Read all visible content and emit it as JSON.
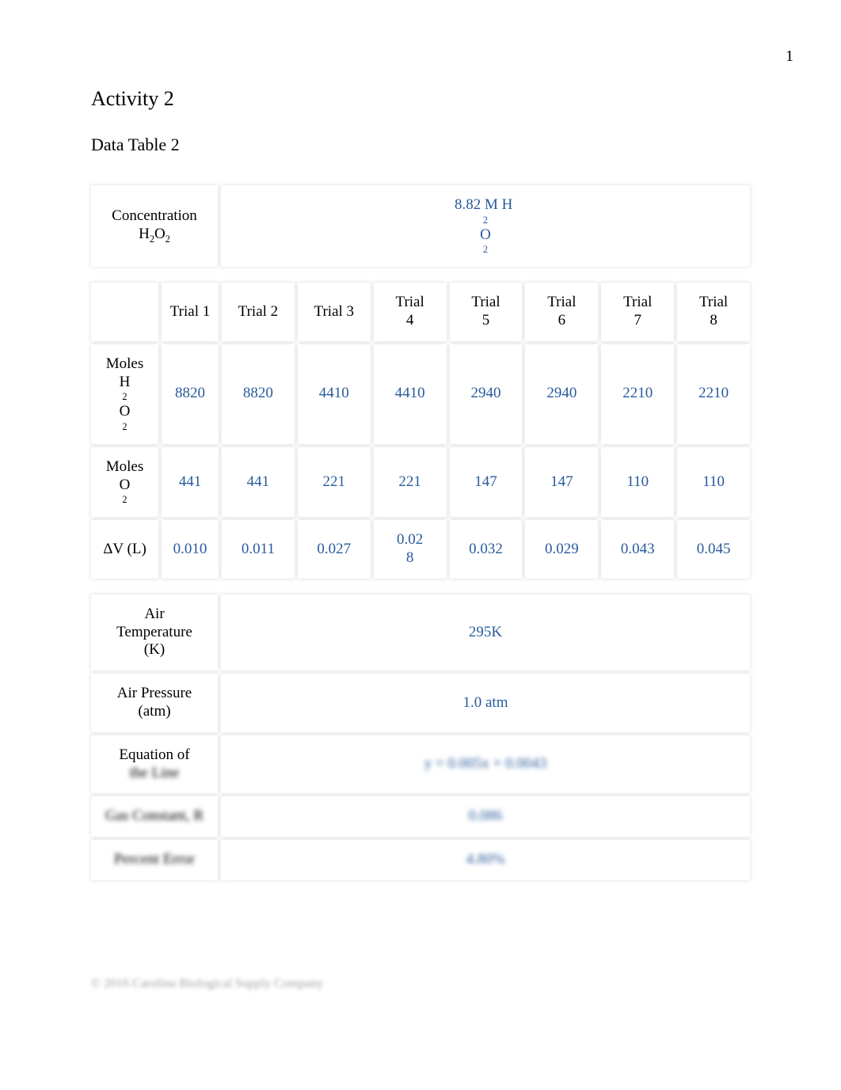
{
  "page_number": "1",
  "title": "Activity 2",
  "subtitle": "Data Table 2",
  "section1": {
    "label": "Concentration H₂O₂",
    "value": "8.82 M H  ₂O₂"
  },
  "trials": {
    "row_label_col": "",
    "header": [
      "Trial 1",
      "Trial 2",
      "Trial 3",
      "Trial 4",
      "Trial 5",
      "Trial 6",
      "Trial 7",
      "Trial 8"
    ],
    "rows": [
      {
        "label": "Moles H₂O₂",
        "values": [
          "8820",
          "8820",
          "4410",
          "4410",
          "2940",
          "2940",
          "2210",
          "2210"
        ]
      },
      {
        "label": "Moles O₂",
        "values": [
          "441",
          "441",
          "221",
          "221",
          "147",
          "147",
          "110",
          "110"
        ]
      },
      {
        "label": "ΔV (L)",
        "values": [
          "0.010",
          "0.011",
          "0.027",
          "0.028",
          "0.032",
          "0.029",
          "0.043",
          "0.045"
        ]
      }
    ]
  },
  "bottom_rows": [
    {
      "label": "Air Temperature (K)",
      "value": "295K",
      "blur": false
    },
    {
      "label": "Air Pressure (atm)",
      "value": "1.0 atm",
      "blur": false
    },
    {
      "label": "Equation of the Line",
      "value": "y = 0.005x + 0.0043",
      "blur": true,
      "label_blur_partial": true,
      "label_visible": "Equation of"
    },
    {
      "label": "Gas Constant, R",
      "value": "0.086",
      "blur": true,
      "label_blur_partial": false
    },
    {
      "label": "Percent Error",
      "value": "4.80%",
      "blur": true,
      "label_blur_partial": false
    }
  ],
  "footer": "© 2016 Carolina Biological Supply Company"
}
